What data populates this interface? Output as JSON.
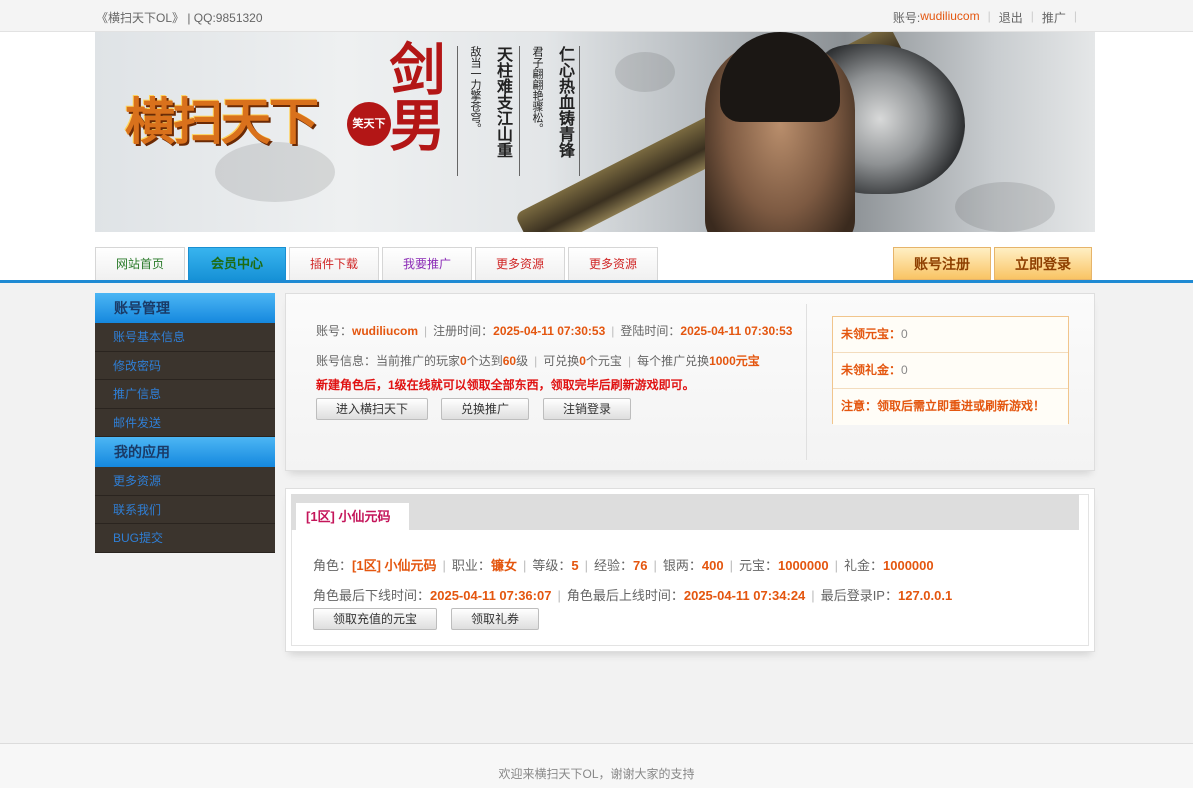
{
  "topbar": {
    "site_title": "《横扫天下OL》 | QQ:9851320",
    "account_label": "账号:",
    "account_value": "wudiliucom",
    "logout": "退出",
    "promote": "推广"
  },
  "banner": {
    "logo_text": "横扫天下",
    "badge_text": "笑天下",
    "title_vertical": "剑男",
    "poem": [
      "敌当一力擎苍穹。",
      "天柱难支江山重",
      "君子翩翩艳骤松。",
      "仁心热血铸青锋"
    ]
  },
  "nav": {
    "tabs": [
      "网站首页",
      "会员中心",
      "插件下载",
      "我要推广",
      "更多资源",
      "更多资源"
    ],
    "register": "账号注册",
    "login": "立即登录"
  },
  "sidebar": {
    "section1": "账号管理",
    "items1": [
      "账号基本信息",
      "修改密码",
      "推广信息",
      "邮件发送"
    ],
    "section2": "我的应用",
    "items2": [
      "更多资源",
      "联系我们",
      "BUG提交"
    ]
  },
  "account_panel": {
    "account_label": "账号：",
    "account": "wudiliucom",
    "reg_label": "注册时间：",
    "reg_time": "2025-04-11 07:30:53",
    "login_label": "登陆时间：",
    "login_time": "2025-04-11 07:30:53",
    "info_pre": "账号信息：当前推广的玩家",
    "promoted_count": "0",
    "info_mid": "个达到",
    "level": "60",
    "info_level_suffix": "级",
    "exchange_pre": "可兑换",
    "exchange_count": "0",
    "exchange_suffix": "个元宝",
    "each_pre": "每个推广兑换",
    "each_value": "1000元宝",
    "notice": "新建角色后，1级在线就可以领取全部东西，领取完毕后刷新游戏即可。",
    "buttons": [
      "进入横扫天下",
      "兑换推广",
      "注销登录"
    ],
    "unclaimed_yuanbao_label": "未领元宝：",
    "unclaimed_yuanbao": "0",
    "unclaimed_gift_label": "未领礼金：",
    "unclaimed_gift": "0",
    "warning": "注意：领取后需立即重进或刷新游戏！"
  },
  "role_panel": {
    "tab": "[1区] 小仙元码",
    "role_label": "角色：",
    "role": "[1区] 小仙元码",
    "job_label": "职业：",
    "job": "镰女",
    "level_label": "等级：",
    "level": "5",
    "exp_label": "经验：",
    "exp": "76",
    "silver_label": "银两：",
    "silver": "400",
    "yuanbao_label": "元宝：",
    "yuanbao": "1000000",
    "gift_label": "礼金：",
    "gift": "1000000",
    "last_off_label": "角色最后下线时间：",
    "last_off": "2025-04-11 07:36:07",
    "last_on_label": "角色最后上线时间：",
    "last_on": "2025-04-11 07:34:24",
    "ip_label": "最后登录IP：",
    "ip": "127.0.0.1",
    "buttons": [
      "领取充值的元宝",
      "领取礼券"
    ]
  },
  "footer": {
    "text": "欢迎来横扫天下OL，谢谢大家的支持"
  }
}
